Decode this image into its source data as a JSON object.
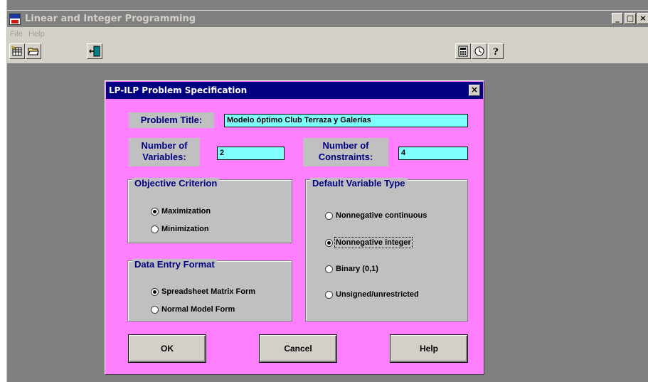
{
  "app": {
    "title": "Linear and Integer Programming",
    "icon": "app-logo-icon"
  },
  "window_controls": {
    "minimize": "_",
    "maximize": "□",
    "close": "×"
  },
  "menu": {
    "items": [
      "File",
      "Help"
    ]
  },
  "toolbar": {
    "left_icons": [
      "new-problem-icon",
      "open-folder-icon",
      "exit-door-icon"
    ],
    "right_icons": [
      "calculator-icon",
      "clock-icon",
      "help-question-icon"
    ]
  },
  "dialog": {
    "title": "LP-ILP Problem Specification",
    "close": "×",
    "problem_title_label": "Problem Title:",
    "problem_title_value": "Modelo óptimo Club Terraza y Galerías",
    "num_variables_label_1": "Number of",
    "num_variables_label_2": "Variables:",
    "num_variables_value": "2",
    "num_constraints_label_1": "Number of",
    "num_constraints_label_2": "Constraints:",
    "num_constraints_value": "4",
    "objective": {
      "title": "Objective Criterion",
      "options": [
        "Maximization",
        "Minimization"
      ],
      "selected": "Maximization"
    },
    "data_entry": {
      "title": "Data Entry Format",
      "options": [
        "Spreadsheet Matrix Form",
        "Normal Model Form"
      ],
      "selected": "Spreadsheet Matrix Form"
    },
    "variable_type": {
      "title": "Default Variable Type",
      "options": [
        "Nonnegative continuous",
        "Nonnegative integer",
        "Binary (0,1)",
        "Unsigned/unrestricted"
      ],
      "selected": "Nonnegative integer"
    },
    "buttons": {
      "ok": "OK",
      "cancel": "Cancel",
      "help": "Help"
    }
  },
  "colors": {
    "dialog_background": "#ff80ff",
    "input_background": "#80ffff",
    "label_text": "#000080",
    "dialog_titlebar": "#000080"
  }
}
